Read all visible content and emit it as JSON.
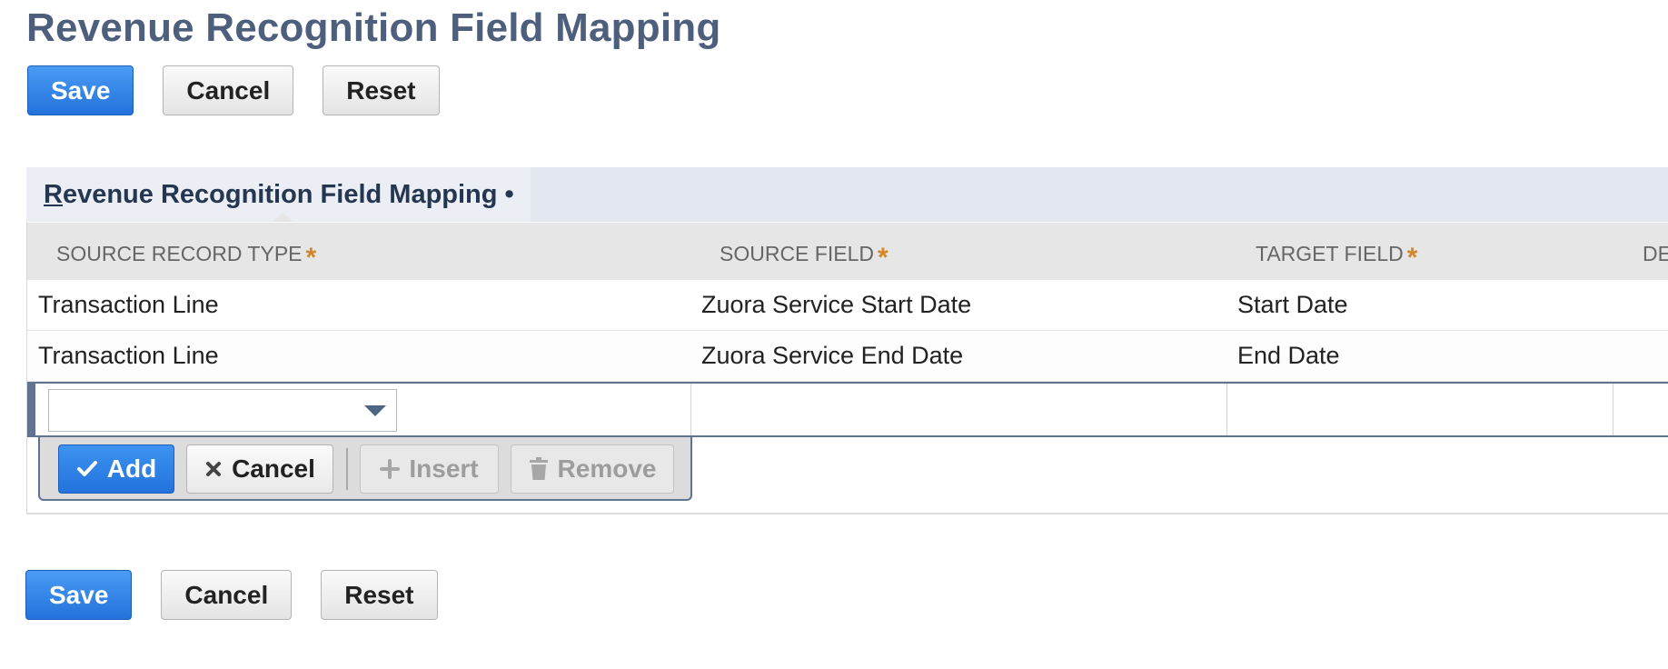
{
  "page": {
    "title": "Revenue Recognition Field Mapping"
  },
  "toolbar_top": {
    "save_label": "Save",
    "cancel_label": "Cancel",
    "reset_label": "Reset"
  },
  "tab": {
    "label_first": "R",
    "label_rest": "evenue Recognition Field Mapping",
    "dot": "•"
  },
  "grid": {
    "columns": [
      {
        "label": "Source Record Type",
        "required": "*"
      },
      {
        "label": "Source Field",
        "required": "*"
      },
      {
        "label": "Target Field",
        "required": "*"
      },
      {
        "label": "Des"
      }
    ],
    "rows": [
      {
        "source_record_type": "Transaction Line",
        "source_field": "Zuora Service Start Date",
        "target_field": "Start Date"
      },
      {
        "source_record_type": "Transaction Line",
        "source_field": "Zuora Service End Date",
        "target_field": "End Date"
      }
    ],
    "edit_row": {
      "source_record_type_value": ""
    }
  },
  "machine_actions": {
    "add_label": "Add",
    "cancel_label": "Cancel",
    "insert_label": "Insert",
    "remove_label": "Remove"
  },
  "toolbar_bottom": {
    "save_label": "Save",
    "cancel_label": "Cancel",
    "reset_label": "Reset"
  },
  "colors": {
    "title": "#4d5f7c",
    "primary_button": "#2372dd",
    "required_star": "#d6862a",
    "edit_row_border": "#607390"
  },
  "icons": {
    "add": "check-icon",
    "cancel": "close-icon",
    "insert": "plus-icon",
    "remove": "trash-icon",
    "select": "chevron-down-icon"
  }
}
